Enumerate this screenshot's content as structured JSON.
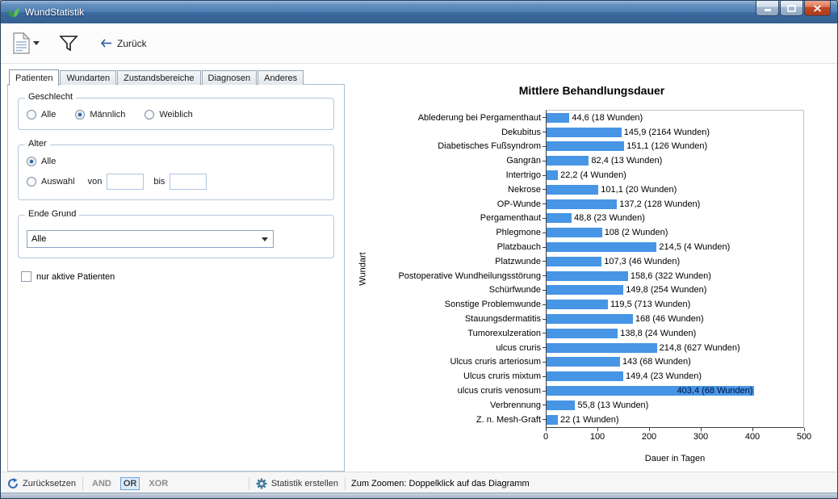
{
  "window": {
    "title": "WundStatistik"
  },
  "toolbar": {
    "back_label": "Zurück"
  },
  "tabs": [
    {
      "label": "Patienten",
      "active": true
    },
    {
      "label": "Wundarten",
      "active": false
    },
    {
      "label": "Zustandsbereiche",
      "active": false
    },
    {
      "label": "Diagnosen",
      "active": false
    },
    {
      "label": "Anderes",
      "active": false
    }
  ],
  "filter_panel": {
    "geschlecht": {
      "label": "Geschlecht",
      "options": [
        {
          "label": "Alle",
          "selected": false
        },
        {
          "label": "Männlich",
          "selected": true
        },
        {
          "label": "Weiblich",
          "selected": false
        }
      ]
    },
    "alter": {
      "label": "Alter",
      "option_alle": {
        "label": "Alle",
        "selected": true
      },
      "option_auswahl": {
        "label": "Auswahl",
        "selected": false
      },
      "von_label": "von",
      "bis_label": "bis",
      "von_value": "",
      "bis_value": ""
    },
    "ende_grund": {
      "label": "Ende Grund",
      "selected_value": "Alle"
    },
    "nur_aktive_checkbox": {
      "label": "nur aktive Patienten",
      "checked": false
    }
  },
  "bottom_bar": {
    "reset_label": "Zurücksetzen",
    "logic_options": [
      "AND",
      "OR",
      "XOR"
    ],
    "logic_selected": "OR",
    "create_label": "Statistik erstellen",
    "zoom_hint": "Zum Zoomen: Doppelklick auf das Diagramm"
  },
  "chart_data": {
    "type": "bar",
    "orientation": "horizontal",
    "title": "Mittlere Behandlungsdauer",
    "xlabel": "Dauer in Tagen",
    "ylabel": "Wundart",
    "xlim": [
      0,
      500
    ],
    "xticks": [
      0,
      100,
      200,
      300,
      400,
      500
    ],
    "bar_color": "#4795e5",
    "highlighted_category": "ulcus cruris venosum",
    "categories": [
      "Ablederung bei Pergamenthaut",
      "Dekubitus",
      "Diabetisches Fußsyndrom",
      "Gangrän",
      "Intertrigo",
      "Nekrose",
      "OP-Wunde",
      "Pergamenthaut",
      "Phlegmone",
      "Platzbauch",
      "Platzwunde",
      "Postoperative Wundheilungsstörung",
      "Schürfwunde",
      "Sonstige Problemwunde",
      "Stauungsdermatitis",
      "Tumorexulzeration",
      "ulcus cruris",
      "Ulcus cruris arteriosum",
      "Ulcus cruris mixtum",
      "ulcus cruris venosum",
      "Verbrennung",
      "Z. n. Mesh-Graft"
    ],
    "values": [
      44.6,
      145.9,
      151.1,
      82.4,
      22.2,
      101.1,
      137.2,
      48.8,
      108,
      214.5,
      107.3,
      158.6,
      149.8,
      119.5,
      168,
      138.8,
      214.8,
      143,
      149.4,
      403.4,
      55.8,
      22
    ],
    "bar_labels": [
      "44,6 (18 Wunden)",
      "145,9 (2164 Wunden)",
      "151,1 (126 Wunden)",
      "82,4 (13 Wunden)",
      "22,2 (4 Wunden)",
      "101,1 (20 Wunden)",
      "137,2 (128 Wunden)",
      "48,8 (23 Wunden)",
      "108 (2 Wunden)",
      "214,5 (4 Wunden)",
      "107,3 (46 Wunden)",
      "158,6 (322 Wunden)",
      "149,8 (254 Wunden)",
      "119,5 (713 Wunden)",
      "168 (46 Wunden)",
      "138,8 (24 Wunden)",
      "214,8 (627 Wunden)",
      "143 (68 Wunden)",
      "149,4 (23 Wunden)",
      "403,4 (68 Wunden)",
      "55,8 (13 Wunden)",
      "22 (1 Wunden)"
    ]
  }
}
